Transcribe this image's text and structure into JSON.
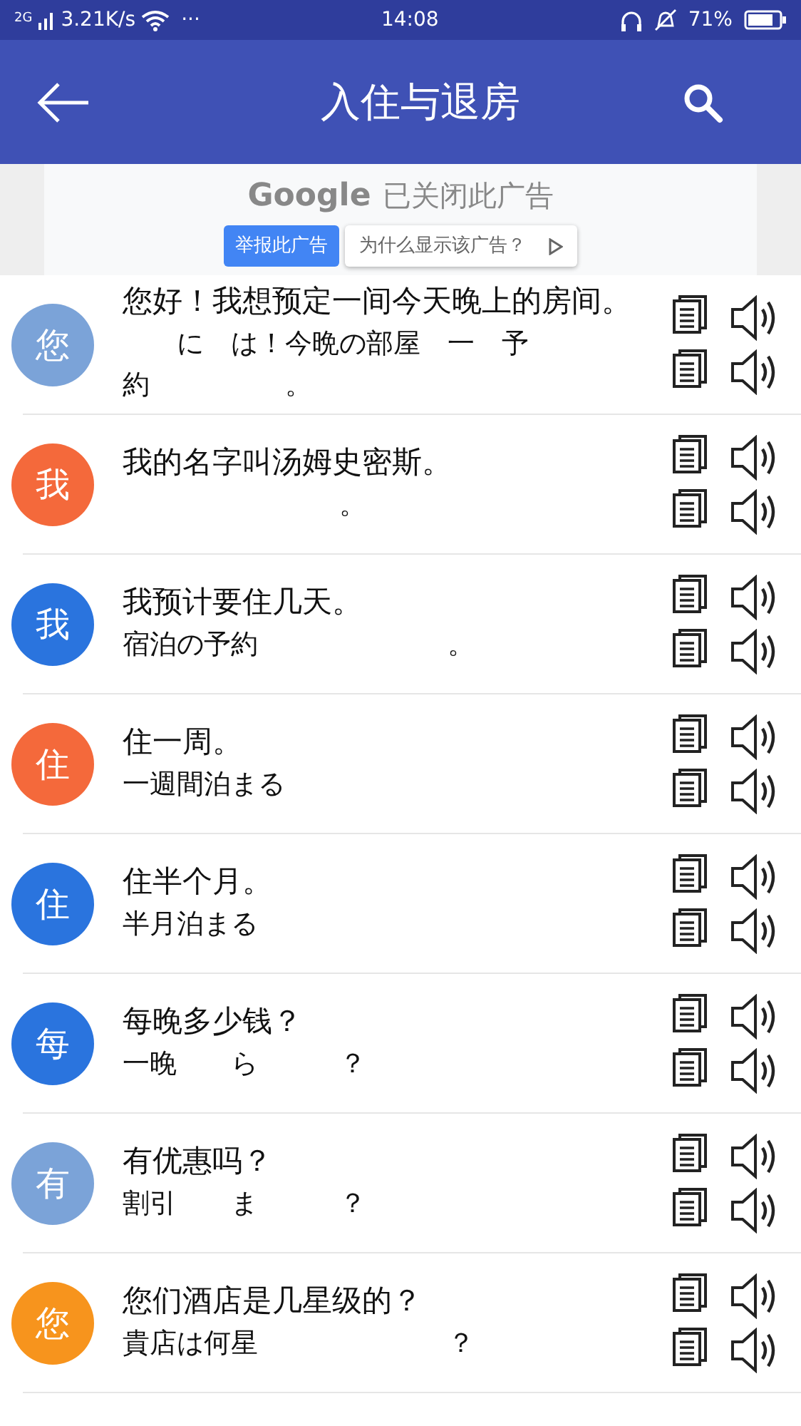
{
  "status_bar": {
    "network": "2G",
    "speed": "3.21K/s",
    "more": "···",
    "time": "14:08",
    "battery": "71%"
  },
  "toolbar": {
    "title": "入住与退房"
  },
  "ad": {
    "brand": "Google",
    "message": "已关闭此广告",
    "report_button": "举报此广告",
    "why_button": "为什么显示该广告？"
  },
  "phrases": [
    {
      "avatar": "您",
      "color": "#7ba3d8",
      "chinese": "您好！我想预定一间今天晚上的房间。",
      "japanese": "　　に　は！今晩の部屋　一　予約　　　　　。"
    },
    {
      "avatar": "我",
      "color": "#f4693b",
      "chinese": "我的名字叫汤姆史密斯。",
      "japanese": "　　　　　　　　。"
    },
    {
      "avatar": "我",
      "color": "#2a74de",
      "chinese": "我预计要住几天。",
      "japanese": "宿泊の予約　　　　　　　。"
    },
    {
      "avatar": "住",
      "color": "#f4693b",
      "chinese": "住一周。",
      "japanese": "一週間泊まる"
    },
    {
      "avatar": "住",
      "color": "#2a74de",
      "chinese": "住半个月。",
      "japanese": "半月泊まる"
    },
    {
      "avatar": "每",
      "color": "#2a74de",
      "chinese": "每晚多少钱？",
      "japanese": "一晚　　ら　　　？"
    },
    {
      "avatar": "有",
      "color": "#7ba3d8",
      "chinese": "有优惠吗？",
      "japanese": "割引　　ま　　　？"
    },
    {
      "avatar": "您",
      "color": "#f7941d",
      "chinese": "您们酒店是几星级的？",
      "japanese": "貴店は何星　　　　　　　？"
    }
  ]
}
